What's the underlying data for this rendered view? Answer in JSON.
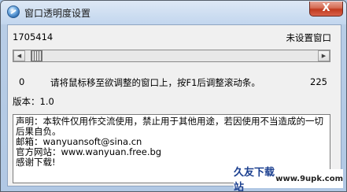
{
  "window": {
    "title": "窗口透明度设置",
    "close_label": "X"
  },
  "status": {
    "handle": "1705414",
    "window_state": "未设置窗口"
  },
  "slider": {
    "min_label": "0",
    "max_label": "225",
    "instruction": "请将鼠标移至欲调整的窗口上，按F1后调整滚动条。",
    "value_fraction": 0.02,
    "left_arrow": "◀",
    "right_arrow": "▶"
  },
  "version": "版本：1.0",
  "notes": {
    "line1": "声明：本软件仅用作交流使用，禁止用于其他用途，若因使用不当造成的一切后果自负。",
    "line2": "邮箱：wanyuansoft@sina.cn",
    "line3": "官方网站：www.wanyuan.free.bg",
    "line4": "感谢下载!"
  },
  "watermark": {
    "cn": "久友下载站",
    "url": "www.9upk.com"
  }
}
